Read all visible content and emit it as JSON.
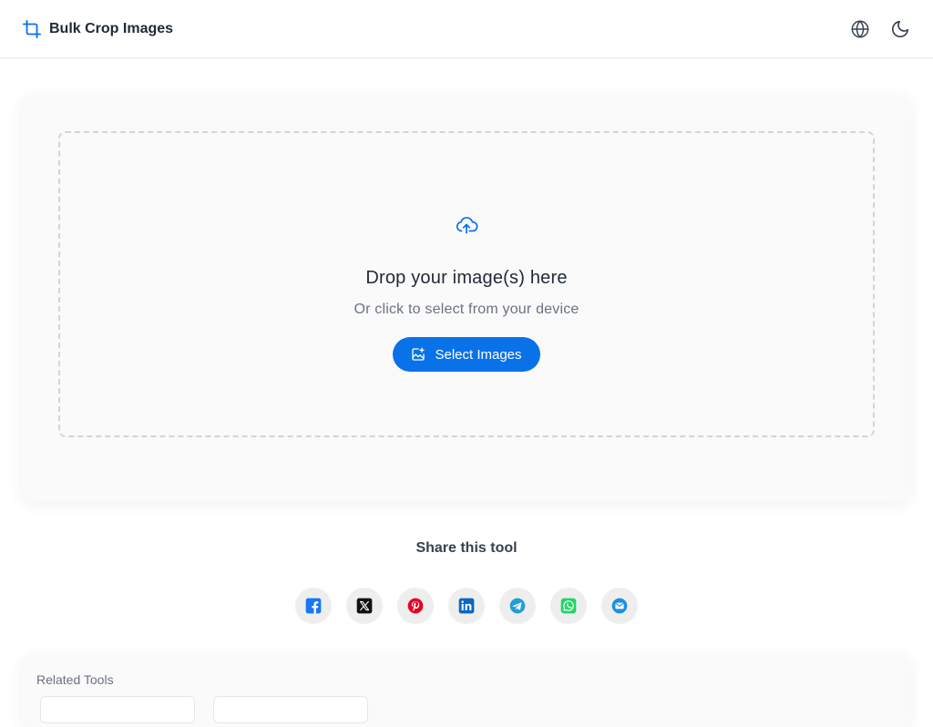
{
  "header": {
    "title": "Bulk Crop Images",
    "brand_icon": "crop-icon",
    "actions": [
      {
        "name": "language-button",
        "icon": "globe-icon"
      },
      {
        "name": "theme-toggle-button",
        "icon": "moon-icon"
      }
    ]
  },
  "upload": {
    "icon": "cloud-upload-icon",
    "title": "Drop your image(s) here",
    "subtitle": "Or click to select from your device",
    "button_label": "Select Images",
    "button_icon": "image-add-icon"
  },
  "share": {
    "title": "Share this tool",
    "items": [
      {
        "name": "facebook",
        "icon": "facebook-icon",
        "color": "#1877f2"
      },
      {
        "name": "x",
        "icon": "x-icon",
        "color": "#111111"
      },
      {
        "name": "pinterest",
        "icon": "pinterest-icon",
        "color": "#e60023"
      },
      {
        "name": "linkedin",
        "icon": "linkedin-icon",
        "color": "#0a66c2"
      },
      {
        "name": "telegram",
        "icon": "telegram-icon",
        "color": "#229ed9"
      },
      {
        "name": "whatsapp",
        "icon": "whatsapp-icon",
        "color": "#25d366"
      },
      {
        "name": "email",
        "icon": "email-icon",
        "color": "#1a8fe3"
      }
    ]
  },
  "related": {
    "title": "Related Tools"
  },
  "colors": {
    "accent": "#0a72e8",
    "text": "#1f2937",
    "muted": "#6b7280"
  }
}
